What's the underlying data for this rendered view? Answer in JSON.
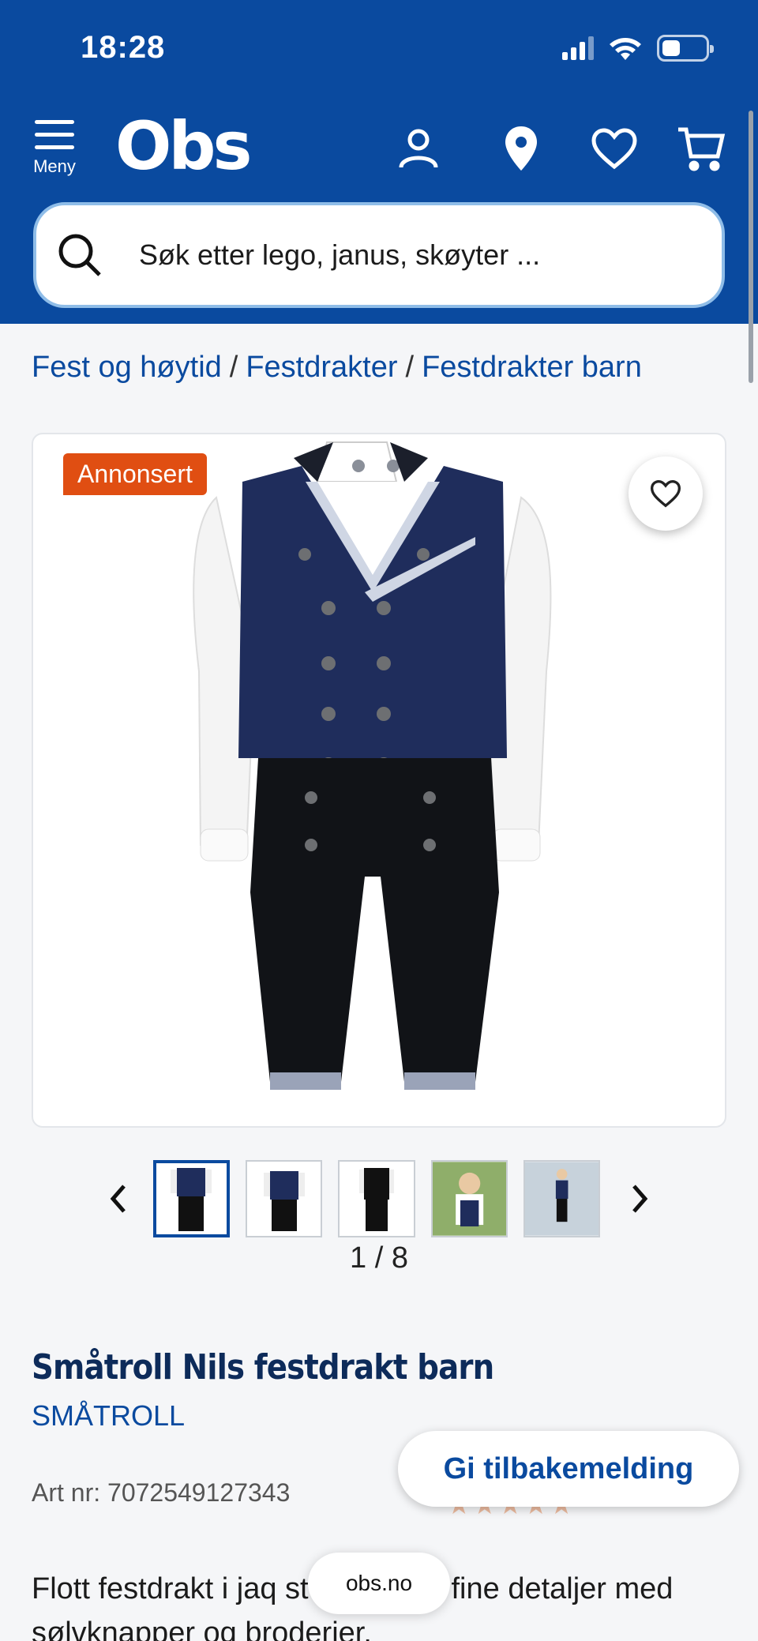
{
  "status_bar": {
    "time": "18:28"
  },
  "header": {
    "menu_label": "Meny",
    "logo": "Obs",
    "search_placeholder": "Søk etter lego, janus, skøyter ..."
  },
  "breadcrumb": [
    "Fest og høytid",
    "Festdrakter",
    "Festdrakter barn"
  ],
  "gallery": {
    "badge": "Annonsert",
    "counter": "1 / 8",
    "thumbnail_count": 5,
    "active_index": 0
  },
  "product": {
    "title": "Småtroll Nils festdrakt barn",
    "brand": "SMÅTROLL",
    "art_nr": "Art nr: 7072549127343",
    "description": "Flott festdrakt i jaq         stoff. Ekstra fine detaljer med sølvknapper og broderier."
  },
  "feedback_button": "Gi tilbakemelding",
  "url_pill": "obs.no",
  "colors": {
    "brand_blue": "#0a4a9f",
    "badge_orange": "#e04e12"
  }
}
